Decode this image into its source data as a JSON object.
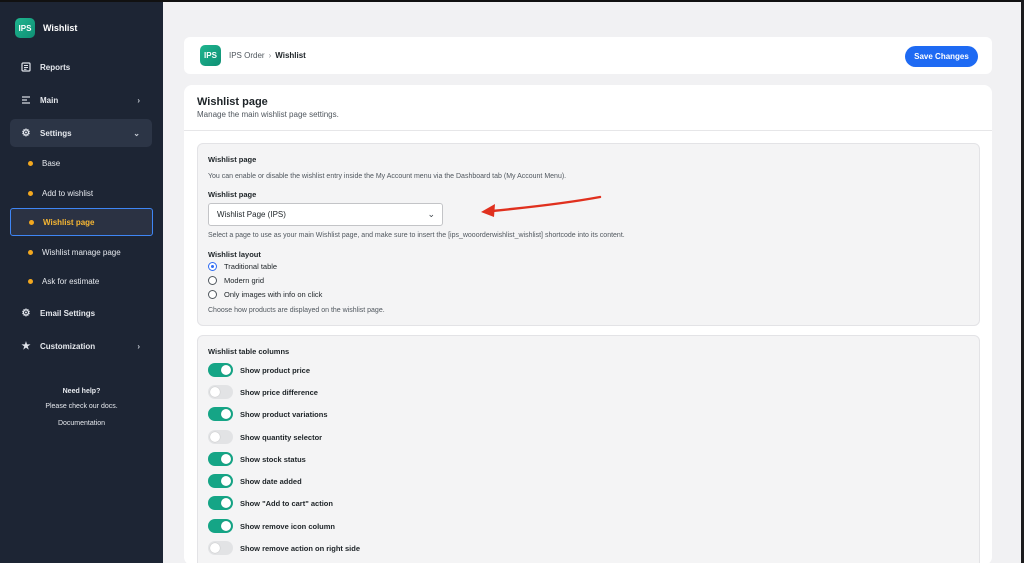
{
  "brand": {
    "logo_text": "IPS",
    "title": "Wishlist",
    "accent_color": "#1fb58f"
  },
  "sidebar": {
    "items": [
      {
        "label": "Reports",
        "icon": "report-icon"
      },
      {
        "label": "Main",
        "icon": "list-icon",
        "chevron": "›"
      },
      {
        "label": "Settings",
        "icon": "gear-icon",
        "chevron": "⌄"
      },
      {
        "label": "Email Settings",
        "icon": "gear-icon"
      },
      {
        "label": "Customization",
        "icon": "star-icon",
        "chevron": "›"
      }
    ],
    "sub_items": [
      {
        "label": "Base"
      },
      {
        "label": "Add to wishlist"
      },
      {
        "label": "Wishlist page",
        "selected": true
      },
      {
        "label": "Wishlist manage page"
      },
      {
        "label": "Ask for estimate"
      }
    ],
    "help": {
      "title": "Need help?",
      "text": "Please check our docs.",
      "link": "Documentation"
    }
  },
  "header": {
    "logo_text": "IPS",
    "breadcrumb": {
      "parent": "IPS Order",
      "separator": "›",
      "current": "Wishlist"
    },
    "save_label": "Save Changes",
    "save_color": "#1e6af3"
  },
  "panel": {
    "title": "Wishlist page",
    "subtitle": "Manage the main wishlist page settings."
  },
  "section1": {
    "title": "Wishlist page",
    "description": "You can enable or disable the wishlist entry inside the My Account menu via the Dashboard tab (My Account Menu).",
    "select_label": "Wishlist page",
    "select_value": "Wishlist Page (IPS)",
    "select_help": "Select a page to use as your main Wishlist page, and make sure to insert the [ips_wooorderwishlist_wishlist] shortcode into its content.",
    "layout_label": "Wishlist layout",
    "layout_options": [
      {
        "label": "Traditional table",
        "checked": true
      },
      {
        "label": "Modern grid",
        "checked": false
      },
      {
        "label": "Only images with info on click",
        "checked": false
      }
    ],
    "layout_help": "Choose how products are displayed on the wishlist page."
  },
  "section2": {
    "title": "Wishlist table columns",
    "toggles": [
      {
        "label": "Show product price",
        "on": true
      },
      {
        "label": "Show price difference",
        "on": false
      },
      {
        "label": "Show product variations",
        "on": true
      },
      {
        "label": "Show quantity selector",
        "on": false
      },
      {
        "label": "Show stock status",
        "on": true
      },
      {
        "label": "Show date added",
        "on": true
      },
      {
        "label": "Show \"Add to cart\" action",
        "on": true
      },
      {
        "label": "Show remove icon column",
        "on": true
      },
      {
        "label": "Show remove action on right side",
        "on": false
      }
    ]
  },
  "annotation": {
    "arrow_color": "#e0301e"
  }
}
